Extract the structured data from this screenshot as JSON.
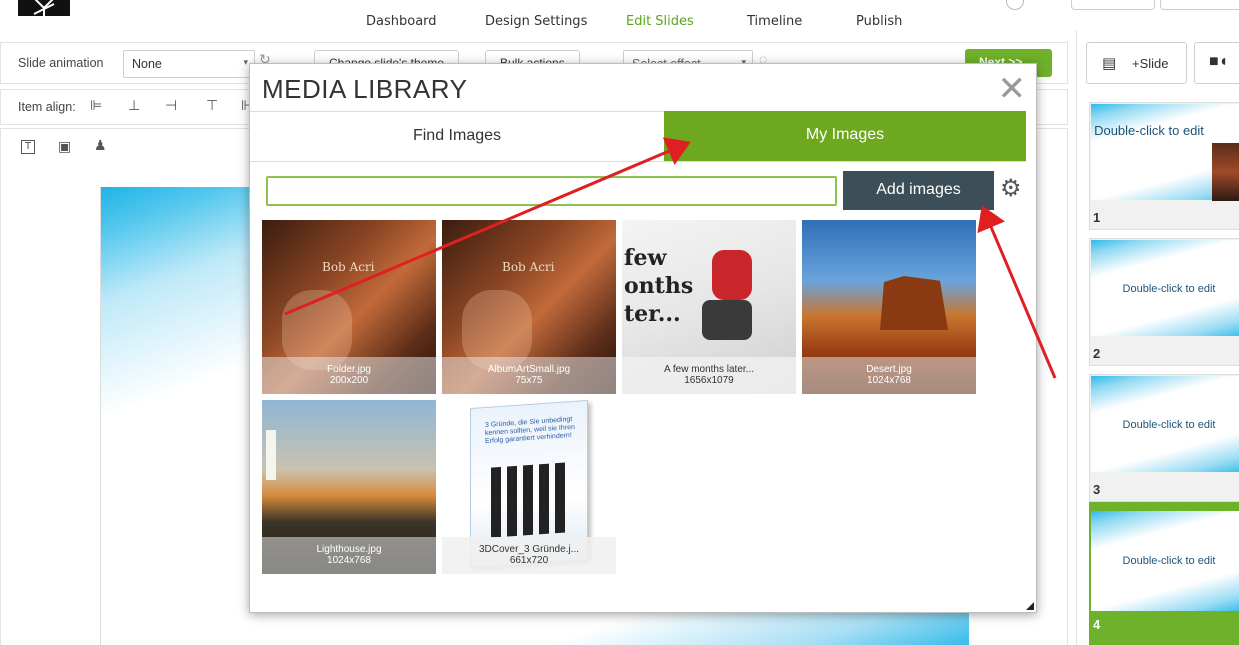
{
  "nav": {
    "items": [
      "Dashboard",
      "Design Settings",
      "Edit Slides",
      "Timeline",
      "Publish"
    ],
    "active": "Edit Slides"
  },
  "toolbar": {
    "slide_animation_label": "Slide animation",
    "slide_animation_value": "None",
    "change_theme_label": "Change slide's theme",
    "bulk_actions_label": "Bulk actions",
    "select_effect_placeholder": "Select effect",
    "next_label": "Next >>",
    "item_align_label": "Item align:"
  },
  "right_panel": {
    "add_slide_label": "+Slide",
    "slides": [
      {
        "number": "1",
        "text": "Double-click to edit"
      },
      {
        "number": "2",
        "text": "Double-click to edit"
      },
      {
        "number": "3",
        "text": "Double-click to edit"
      },
      {
        "number": "4",
        "text": "Double-click to edit"
      }
    ]
  },
  "modal": {
    "title": "MEDIA LIBRARY",
    "tabs": {
      "find": "Find Images",
      "my": "My Images"
    },
    "active_tab": "My Images",
    "search_value": "",
    "add_images_label": "Add images",
    "images": [
      {
        "name": "Folder.jpg",
        "size": "200x200"
      },
      {
        "name": "AlbumArtSmall.jpg",
        "size": "75x75"
      },
      {
        "name": "A few months later...",
        "size": "1656x1079"
      },
      {
        "name": "Desert.jpg",
        "size": "1024x768"
      },
      {
        "name": "Lighthouse.jpg",
        "size": "1024x768"
      },
      {
        "name": "3DCover_3 Gründe.j...",
        "size": "661x720"
      }
    ],
    "tile_texts": {
      "album_title": "Bob Acri",
      "ski_text_1": "few",
      "ski_text_2": "onths",
      "ski_text_3": "ter...",
      "book_text": "3 Gründe, die Sie unbedingt kennen sollten, weil sie Ihren Erfolg garantiert verhindern!"
    }
  },
  "colors": {
    "accent_green": "#6ea81e",
    "nav_active": "#5da31c",
    "add_images_bg": "#3c4e57",
    "arrow_red": "#e02020"
  }
}
